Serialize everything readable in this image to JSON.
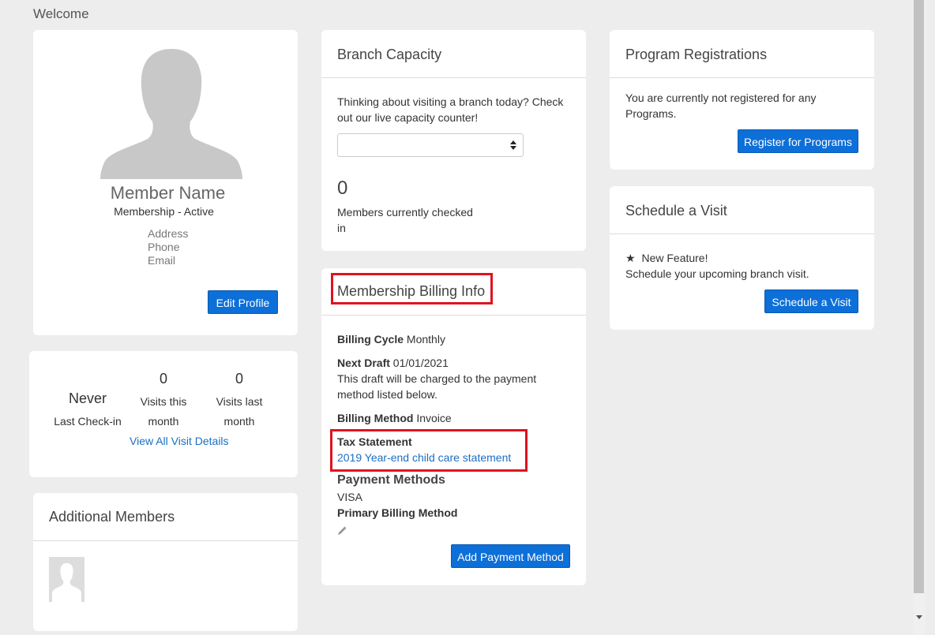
{
  "page": {
    "welcome": "Welcome"
  },
  "profile": {
    "name": "Member Name",
    "status": "Membership - Active",
    "address": "Address",
    "phone": "Phone",
    "email": "Email",
    "edit_label": "Edit Profile"
  },
  "visits": {
    "last_checkin_value": "Never",
    "last_checkin_label": "Last Check-in",
    "this_month_value": "0",
    "this_month_label_1": "Visits this",
    "this_month_label_2": "month",
    "last_month_value": "0",
    "last_month_label_1": "Visits last",
    "last_month_label_2": "month",
    "link": "View All Visit Details"
  },
  "additional_members": {
    "title": "Additional Members"
  },
  "branch_capacity": {
    "title": "Branch Capacity",
    "description": "Thinking about visiting a branch today? Check out our live capacity counter!",
    "select_value": "",
    "count": "0",
    "count_label_1": "Members currently checked",
    "count_label_2": "in"
  },
  "billing": {
    "title": "Membership Billing Info",
    "cycle_label": "Billing Cycle",
    "cycle_value": "Monthly",
    "next_draft_label": "Next Draft",
    "next_draft_value": "01/01/2021",
    "draft_note_1": "This draft will be charged to the payment",
    "draft_note_2": "method listed below.",
    "method_label": "Billing Method",
    "method_value": "Invoice",
    "tax_label": "Tax Statement",
    "tax_link": "2019 Year-end child care statement",
    "payment_methods_title": "Payment Methods",
    "payment_card": "VISA",
    "primary_label": "Primary Billing Method",
    "add_payment_label": "Add Payment Method"
  },
  "programs": {
    "title": "Program Registrations",
    "text_1": "You are currently not registered for any",
    "text_2": "Programs.",
    "register_label": "Register for Programs"
  },
  "visit_schedule": {
    "title": "Schedule a Visit",
    "feature_star": "★",
    "feature_label": "New Feature!",
    "description": "Schedule your upcoming branch visit.",
    "button_label": "Schedule a Visit"
  },
  "colors": {
    "accent": "#0d6fd8",
    "highlight": "#e0121f",
    "link": "#1a6fc4",
    "background": "#ededed"
  }
}
